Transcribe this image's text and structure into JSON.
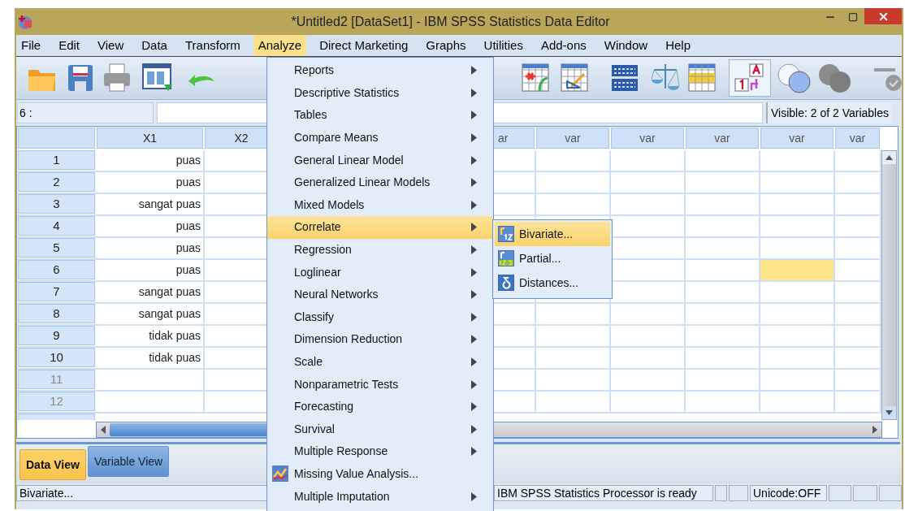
{
  "window": {
    "title": "*Untitled2 [DataSet1] - IBM SPSS Statistics Data Editor"
  },
  "menu_bar": [
    {
      "label": "File",
      "selected": false
    },
    {
      "label": "Edit",
      "selected": false
    },
    {
      "label": "View",
      "selected": false
    },
    {
      "label": "Data",
      "selected": false
    },
    {
      "label": "Transform",
      "selected": false
    },
    {
      "label": "Analyze",
      "selected": true
    },
    {
      "label": "Direct Marketing",
      "selected": false
    },
    {
      "label": "Graphs",
      "selected": false
    },
    {
      "label": "Utilities",
      "selected": false
    },
    {
      "label": "Add-ons",
      "selected": false
    },
    {
      "label": "Window",
      "selected": false
    },
    {
      "label": "Help",
      "selected": false
    }
  ],
  "toolbar": {
    "value_labels_on": true
  },
  "analyze_menu": [
    {
      "label": "Reports",
      "kind": "submenu",
      "selected": false
    },
    {
      "label": "Descriptive Statistics",
      "kind": "submenu",
      "selected": false
    },
    {
      "label": "Tables",
      "kind": "submenu",
      "selected": false
    },
    {
      "label": "Compare Means",
      "kind": "submenu",
      "selected": false
    },
    {
      "label": "General Linear Model",
      "kind": "submenu",
      "selected": false
    },
    {
      "label": "Generalized Linear Models",
      "kind": "submenu",
      "selected": false
    },
    {
      "label": "Mixed Models",
      "kind": "submenu",
      "selected": false
    },
    {
      "label": "Correlate",
      "kind": "submenu",
      "selected": true
    },
    {
      "label": "Regression",
      "kind": "submenu",
      "selected": false
    },
    {
      "label": "Loglinear",
      "kind": "submenu",
      "selected": false
    },
    {
      "label": "Neural Networks",
      "kind": "submenu",
      "selected": false
    },
    {
      "label": "Classify",
      "kind": "submenu",
      "selected": false
    },
    {
      "label": "Dimension Reduction",
      "kind": "submenu",
      "selected": false
    },
    {
      "label": "Scale",
      "kind": "submenu",
      "selected": false
    },
    {
      "label": "Nonparametric Tests",
      "kind": "submenu",
      "selected": false
    },
    {
      "label": "Forecasting",
      "kind": "submenu",
      "selected": false
    },
    {
      "label": "Survival",
      "kind": "submenu",
      "selected": false
    },
    {
      "label": "Multiple Response",
      "kind": "submenu",
      "selected": false
    },
    {
      "label": "Missing Value Analysis...",
      "kind": "command",
      "selected": false
    },
    {
      "label": "Multiple Imputation",
      "kind": "submenu",
      "selected": false
    }
  ],
  "correlate_submenu": [
    {
      "label": "Bivariate...",
      "kind": "bivariate",
      "selected": true
    },
    {
      "label": "Partial...",
      "kind": "partial",
      "selected": false
    },
    {
      "label": "Distances...",
      "kind": "distances",
      "selected": false
    }
  ],
  "cell_reference": "6 :",
  "visible_variables": "Visible: 2 of 2 Variables",
  "columns_left": [
    {
      "label": "X1"
    },
    {
      "label": "X2"
    }
  ],
  "columns_right": [
    {
      "label": "ar"
    },
    {
      "label": "var"
    },
    {
      "label": "var"
    },
    {
      "label": "var"
    },
    {
      "label": "var"
    },
    {
      "label": "var"
    }
  ],
  "rows": [
    {
      "number": "1",
      "x1": "puas",
      "selected": false
    },
    {
      "number": "2",
      "x1": "puas",
      "selected": false
    },
    {
      "number": "3",
      "x1": "sangat puas",
      "selected": false
    },
    {
      "number": "4",
      "x1": "puas",
      "selected": false
    },
    {
      "number": "5",
      "x1": "puas",
      "selected": false
    },
    {
      "number": "6",
      "x1": "puas",
      "selected": true
    },
    {
      "number": "7",
      "x1": "sangat puas",
      "selected": false
    },
    {
      "number": "8",
      "x1": "sangat puas",
      "selected": false
    },
    {
      "number": "9",
      "x1": "tidak puas",
      "selected": false
    },
    {
      "number": "10",
      "x1": "tidak puas",
      "selected": false
    },
    {
      "number": "11",
      "selected": false
    },
    {
      "number": "12",
      "selected": false
    }
  ],
  "tabs": [
    {
      "label": "Data View",
      "selected": true
    },
    {
      "label": "Variable View",
      "selected": false
    }
  ],
  "status_bar": {
    "message": "Bivariate...",
    "processor": "IBM SPSS Statistics Processor is ready",
    "encoding": "Unicode:OFF"
  }
}
